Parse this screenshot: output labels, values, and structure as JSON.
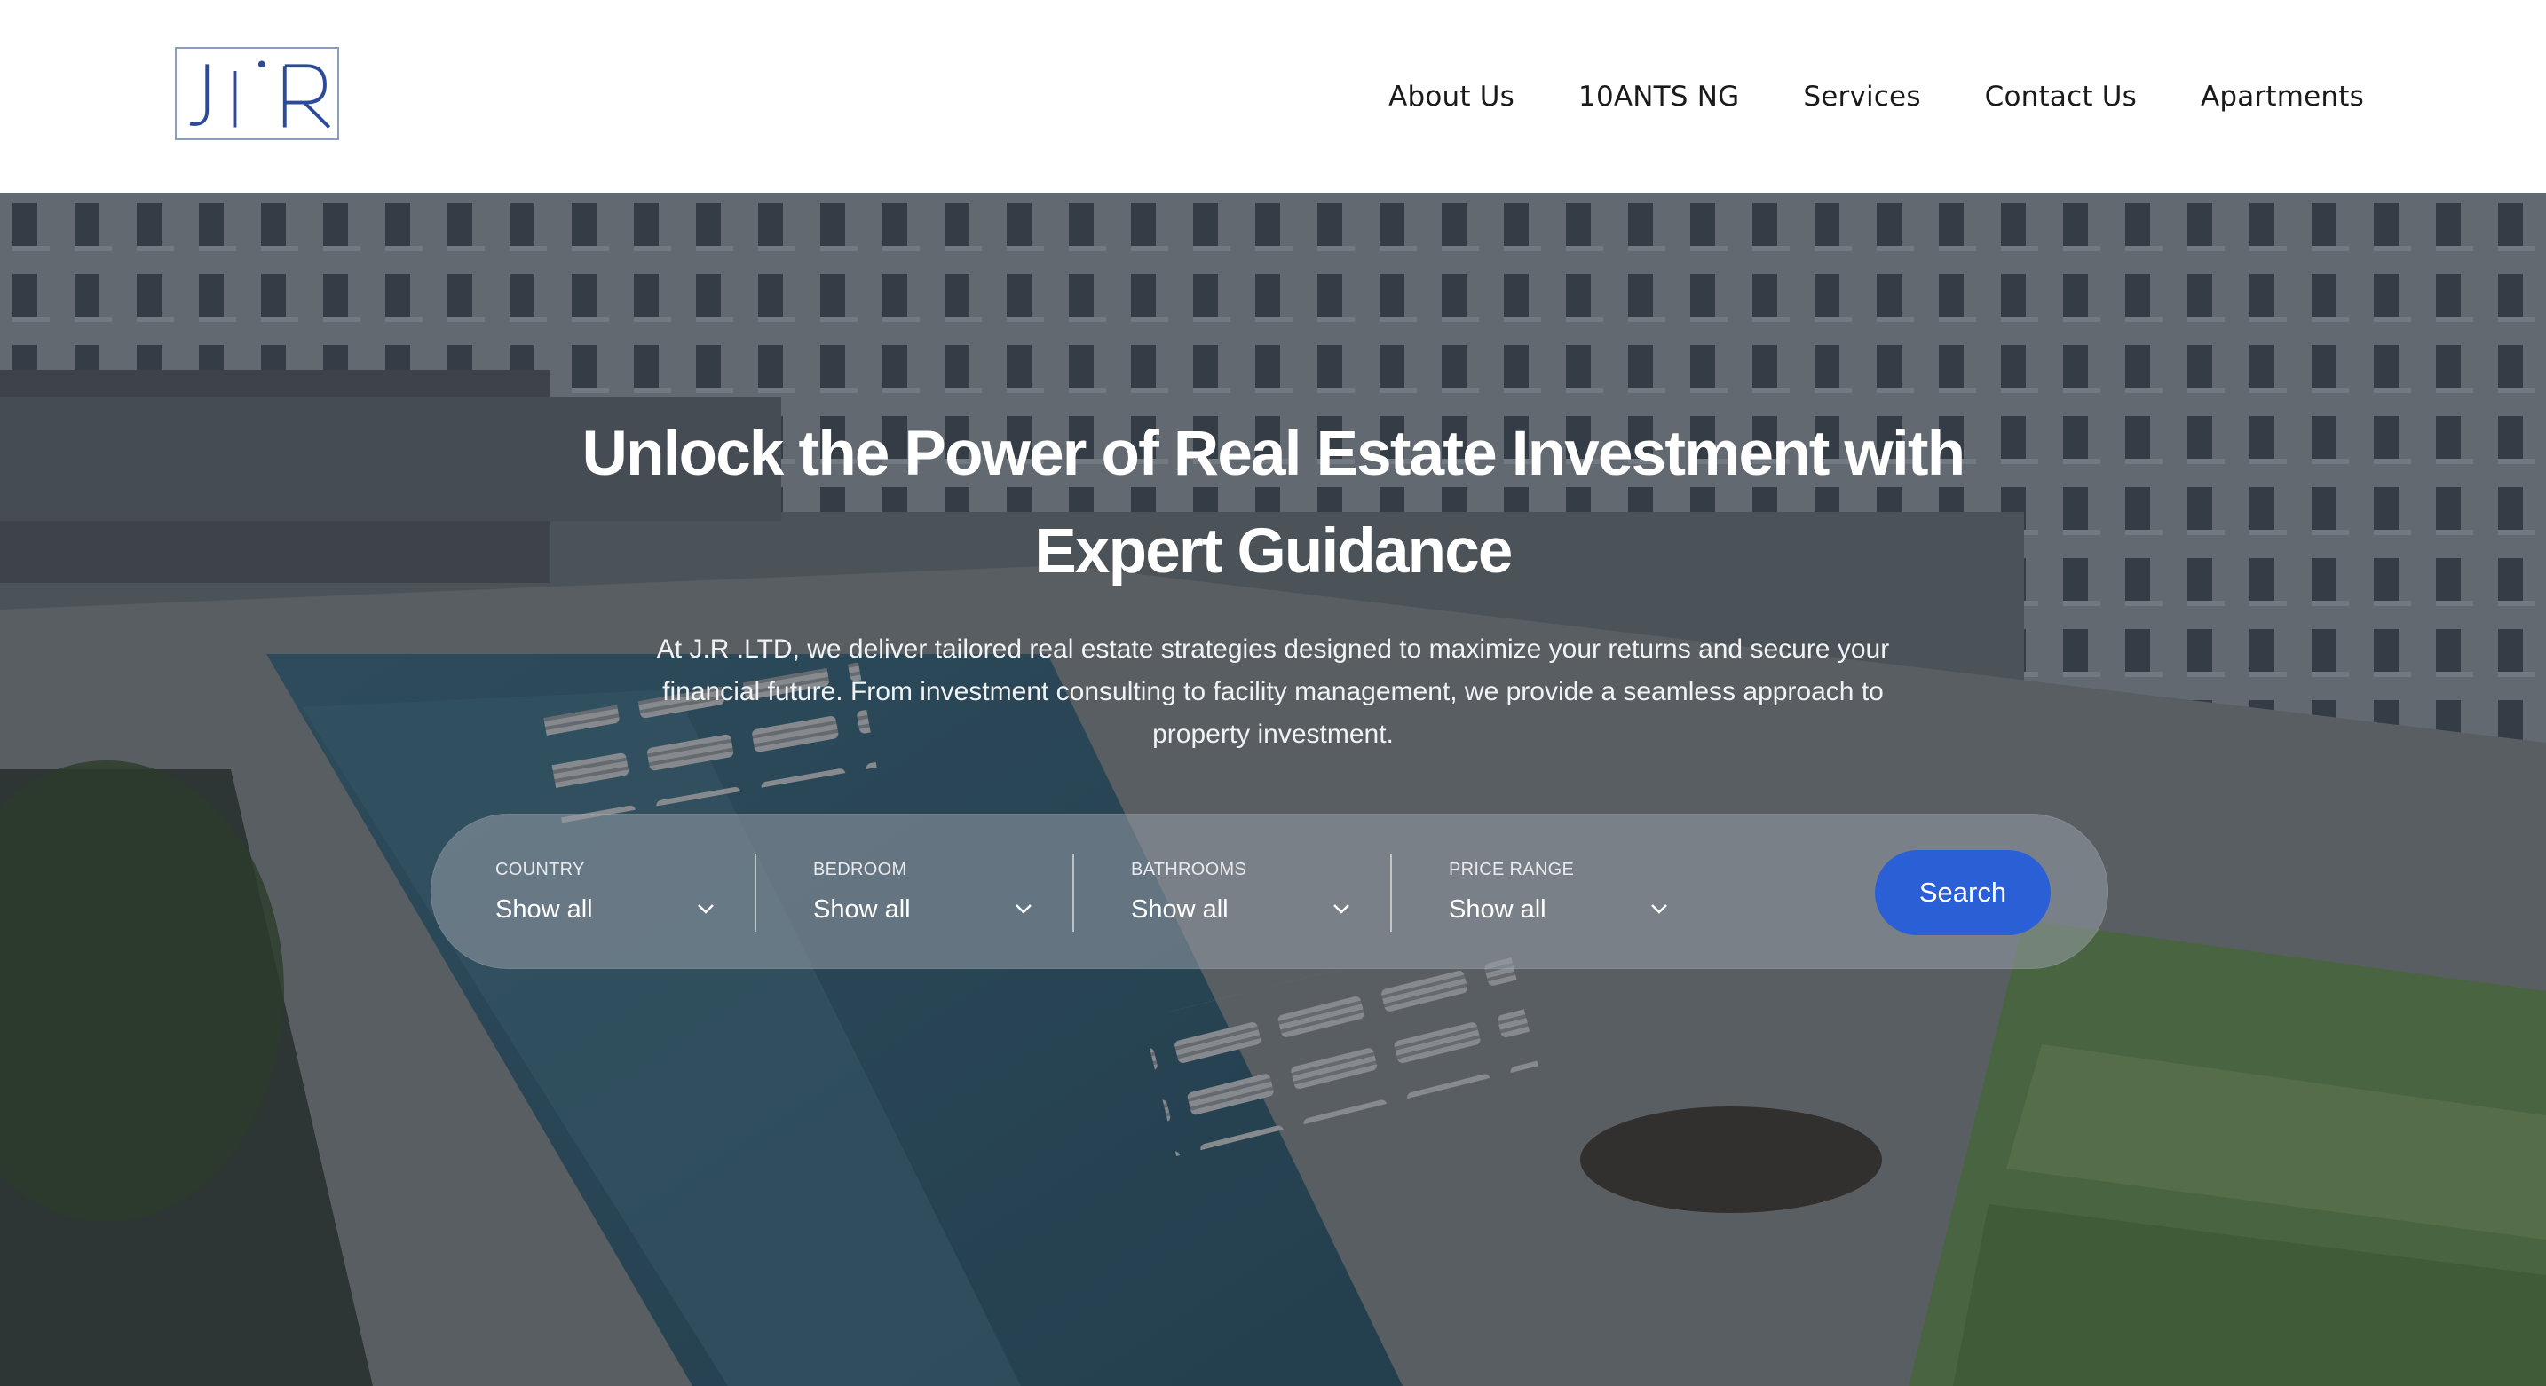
{
  "header": {
    "logo_text": "J'R",
    "nav": [
      "About Us",
      "10ANTS NG",
      "Services",
      "Contact Us",
      "Apartments"
    ]
  },
  "hero": {
    "headline_line1": "Unlock the Power of Real Estate Investment with",
    "headline_line2": "Expert Guidance",
    "subtext_line1": "At J.R .LTD, we deliver tailored real estate strategies designed to maximize your returns and secure your",
    "subtext_line2": "financial future. From investment consulting to facility management, we provide a seamless approach to",
    "subtext_line3": "property investment.",
    "background_image": "apartment-complex-pool-photo"
  },
  "search": {
    "filters": [
      {
        "label": "COUNTRY",
        "value": "Show all"
      },
      {
        "label": "BEDROOM",
        "value": "Show all"
      },
      {
        "label": "BATHROOMS",
        "value": "Show all"
      },
      {
        "label": "PRICE RANGE",
        "value": "Show all"
      }
    ],
    "button_label": "Search"
  },
  "colors": {
    "accent": "#2a5fd6",
    "logo": "#2b4a9a",
    "header_bg": "#ffffff",
    "nav_text": "#1a1a1a"
  }
}
